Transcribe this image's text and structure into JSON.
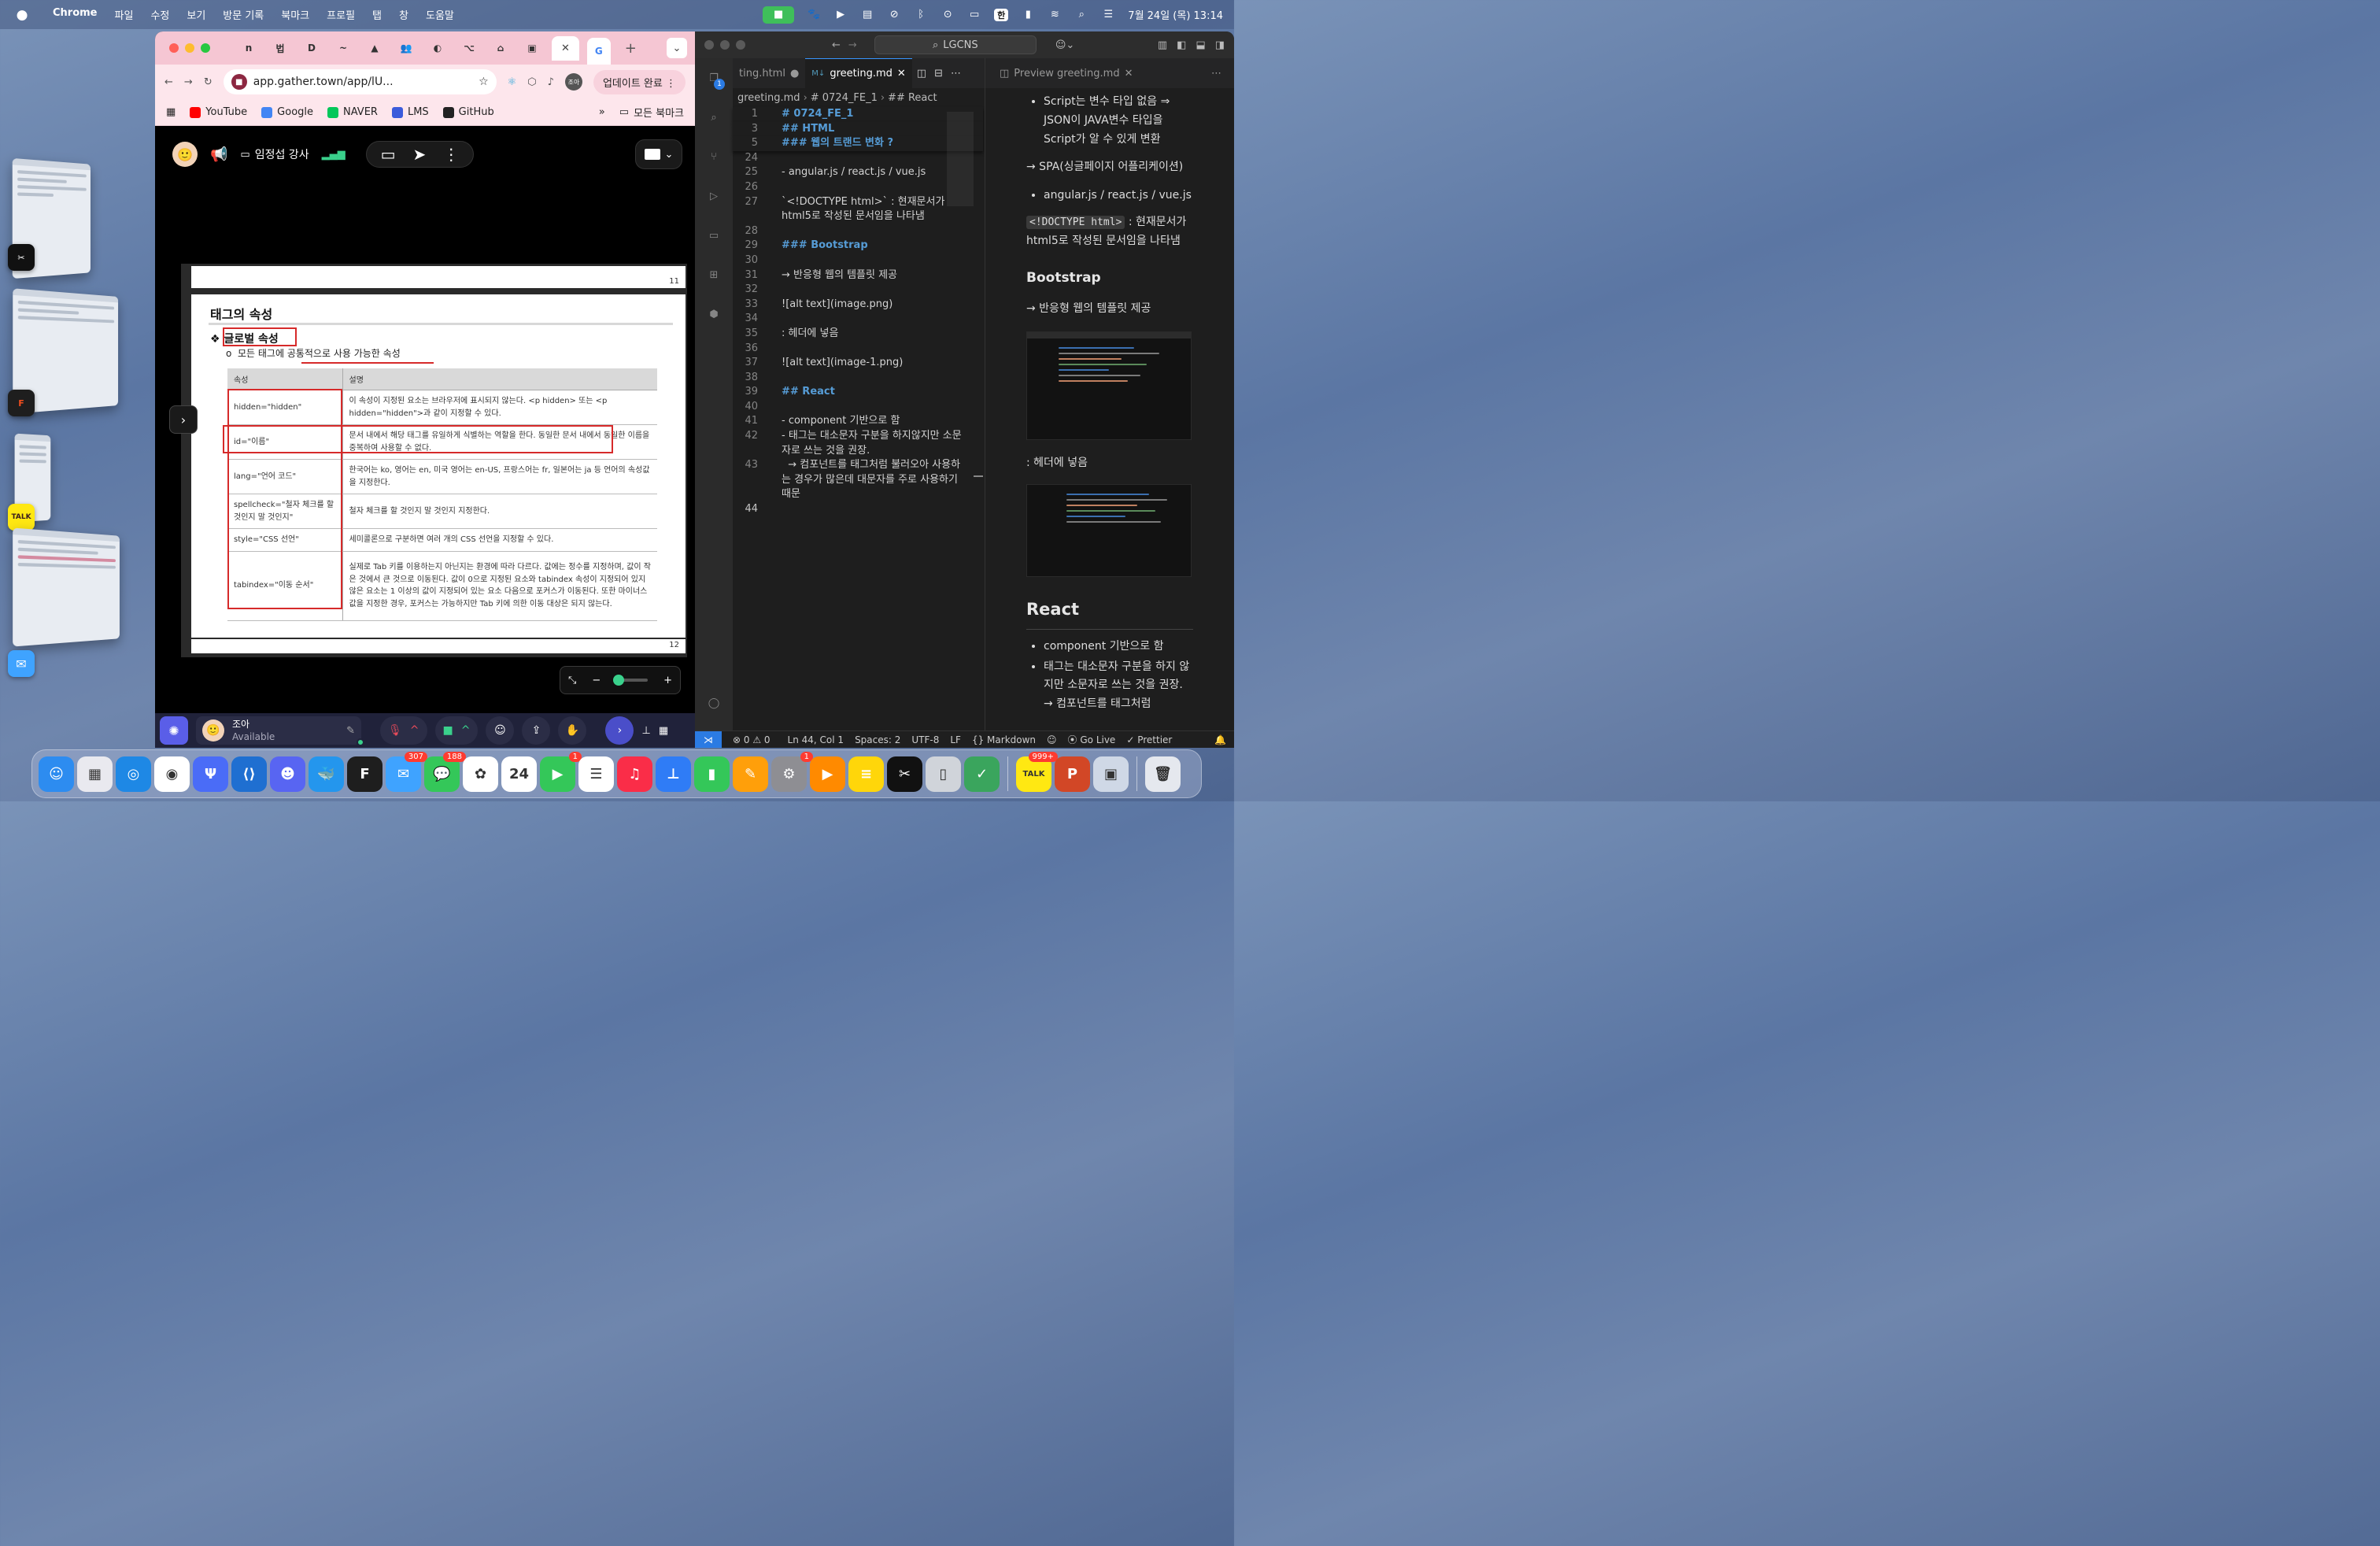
{
  "menubar": {
    "items": [
      "Chrome",
      "파일",
      "수정",
      "보기",
      "방문 기록",
      "북마크",
      "프로필",
      "탭",
      "창",
      "도움말"
    ],
    "input_method": "한",
    "clock": "7월 24일 (목) 13:14"
  },
  "chrome": {
    "tab_icons": [
      "n",
      "법",
      "D",
      "~",
      "▲",
      "👥",
      "◐",
      "⌥",
      "⌂",
      "▣",
      "G"
    ],
    "url": "app.gather.town/app/lU...",
    "profile_label": "조아",
    "update_label": "업데이트 완료",
    "bookmarks": [
      {
        "label": "YouTube",
        "color": "#ff0000"
      },
      {
        "label": "Google",
        "color": "#4285f4"
      },
      {
        "label": "NAVER",
        "color": "#03c75a"
      },
      {
        "label": "LMS",
        "color": "#3b5bdb"
      },
      {
        "label": "GitHub",
        "color": "#222222"
      }
    ],
    "all_bookmarks_label": "모든 북마크"
  },
  "gather": {
    "presenter": "임정섭 강사",
    "slide": {
      "page_top_number": "11",
      "page_bottom_number": "12",
      "title": "태그의 속성",
      "bullet_title": "글로벌 속성",
      "sub_bullet": "모든 태그에 공통적으로 사용 가능한 속성",
      "table_headers": [
        "속성",
        "설명"
      ],
      "table_rows": [
        {
          "attr": "hidden=\"hidden\"",
          "desc": "이 속성이 지정된 요소는 브라우저에 표시되지 않는다. <p hidden> 또는 <p hidden=\"hidden\">과 같이 지정할 수 있다."
        },
        {
          "attr": "id=\"이름\"",
          "desc": "문서 내에서 해당 태그를 유일하게 식별하는 역할을 한다. 동일한 문서 내에서 동일한 이름을 중복하여 사용할 수 없다."
        },
        {
          "attr": "lang=\"언어 코드\"",
          "desc": "한국어는 ko, 영어는 en, 미국 영어는 en-US, 프랑스어는 fr, 일본어는 ja 등 언어의 속성값을 지정한다."
        },
        {
          "attr": "spellcheck=\"철자 체크를 할 것인지 말 것인지\"",
          "desc": "철자 체크를 할 것인지 말 것인지 지정한다."
        },
        {
          "attr": "style=\"CSS 선언\"",
          "desc": "세미콜론으로 구분하면 여러 개의 CSS 선언을 지정할 수 있다."
        },
        {
          "attr": "tabindex=\"이동 순서\"",
          "desc": "실제로 Tab 키를 이용하는지 아닌지는 환경에 따라 다르다. 값에는 정수를 지정하며, 값이 작은 것에서 큰 것으로 이동된다. 값이 0으로 지정된 요소와 tabindex 속성이 지정되어 있지 않은 요소는 1 이상의 값이 지정되어 있는 요소 다음으로 포커스가 이동된다. 또한 마이너스 값을 지정한 경우, 포커스는 가능하지만 Tab 키에 의한 이동 대상은 되지 않는다."
        }
      ]
    },
    "user_name": "조아",
    "user_status": "Available"
  },
  "vscode": {
    "search_label": "LGCNS",
    "tabs": [
      {
        "label": "ting.html",
        "active": false
      },
      {
        "label": "greeting.md",
        "active": true
      }
    ],
    "preview_tab": "Preview greeting.md",
    "breadcrumb": [
      "greeting.md",
      "# 0724_FE_1",
      "## React"
    ],
    "sticky_lines": [
      {
        "num": "1",
        "text": "# 0724_FE_1"
      },
      {
        "num": "3",
        "text": "## HTML"
      },
      {
        "num": "5",
        "text": "### 웹의 트랜드 변화 ?"
      }
    ],
    "code_lines": [
      {
        "num": "24",
        "text": ""
      },
      {
        "num": "25",
        "text": "- angular.js / react.js / vue.js"
      },
      {
        "num": "26",
        "text": ""
      },
      {
        "num": "27",
        "text": "`<!DOCTYPE html>` : 현재문서가 html5로 작성된 문서임을 나타냄"
      },
      {
        "num": "28",
        "text": ""
      },
      {
        "num": "29",
        "text": "### Bootstrap"
      },
      {
        "num": "30",
        "text": ""
      },
      {
        "num": "31",
        "text": "→ 반응형 웹의 템플릿 제공"
      },
      {
        "num": "32",
        "text": ""
      },
      {
        "num": "33",
        "text": "![alt text](image.png)"
      },
      {
        "num": "34",
        "text": ""
      },
      {
        "num": "35",
        "text": ": 헤더에 넣음"
      },
      {
        "num": "36",
        "text": ""
      },
      {
        "num": "37",
        "text": "![alt text](image-1.png)"
      },
      {
        "num": "38",
        "text": ""
      },
      {
        "num": "39",
        "text": "## React"
      },
      {
        "num": "40",
        "text": ""
      },
      {
        "num": "41",
        "text": "- component 기반으로 함"
      },
      {
        "num": "42",
        "text": "- 태그는 대소문자 구분을 하지않지만 소문자로 쓰는 것을 권장."
      },
      {
        "num": "43",
        "text": "  → 컴포넌트를 태그처럼 불러오아 사용하는 경우가 많은데 대문자를 주로 사용하기 때문"
      },
      {
        "num": "44",
        "text": ""
      }
    ],
    "preview": {
      "top_bullet": "Script는 변수 타입 없음 ⇒ JSON이 JAVA변수 타입을 Script가 알 수 있게 변환",
      "spa_line": "→ SPA(싱글페이지 어플리케이션)",
      "frameworks": "angular.js / react.js / vue.js",
      "doctype_code": "<!DOCTYPE html>",
      "doctype_desc": ": 현재문서가 html5로 작성된 문서임을 나타냄",
      "bootstrap_heading": "Bootstrap",
      "bootstrap_line": "→ 반응형 웹의 템플릿 제공",
      "header_line": ": 헤더에 넣음",
      "react_heading": "React",
      "react_bullets": [
        "component 기반으로 함",
        "태그는 대소문자 구분을 하지 않지만 소문자로 쓰는 것을 권장. → 컴포넌트를 태그처럼"
      ]
    },
    "status": {
      "errors": "0",
      "warnings": "0",
      "position": "Ln 44, Col 1",
      "spaces": "Spaces: 2",
      "encoding": "UTF-8",
      "eol": "LF",
      "language": "Markdown",
      "go_live": "Go Live",
      "prettier": "Prettier"
    },
    "activity_badges": {
      "explorer": "1",
      "settings": "1"
    }
  },
  "dock": {
    "apps": [
      {
        "name": "Finder",
        "icon": "finder-icon",
        "color": "#2d8cf0",
        "glyph": "☺"
      },
      {
        "name": "Launchpad",
        "icon": "launchpad-icon",
        "color": "#e9e9ef",
        "glyph": "▦"
      },
      {
        "name": "Safari",
        "icon": "safari-icon",
        "color": "#1e88e5",
        "glyph": "◎"
      },
      {
        "name": "Chrome",
        "icon": "chrome-icon",
        "color": "#ffffff",
        "glyph": "◉"
      },
      {
        "name": "Fork",
        "icon": "fork-icon",
        "color": "#4a6cf7",
        "glyph": "Ψ"
      },
      {
        "name": "VS Code",
        "icon": "vscode-icon",
        "color": "#1f6fd1",
        "glyph": "⟨⟩"
      },
      {
        "name": "Discord",
        "icon": "discord-icon",
        "color": "#5865f2",
        "glyph": "☻"
      },
      {
        "name": "Docker",
        "icon": "docker-icon",
        "color": "#2496ed",
        "glyph": "🐳"
      },
      {
        "name": "Figma",
        "icon": "figma-icon",
        "color": "#1e1e1e",
        "glyph": "F"
      },
      {
        "name": "Mail",
        "icon": "mail-icon",
        "color": "#3fa3ff",
        "glyph": "✉",
        "badge": "307"
      },
      {
        "name": "Messages",
        "icon": "messages-icon",
        "color": "#34c759",
        "glyph": "💬",
        "badge": "188"
      },
      {
        "name": "Photos",
        "icon": "photos-icon",
        "color": "#ffffff",
        "glyph": "✿"
      },
      {
        "name": "Calendar",
        "icon": "calendar-icon",
        "color": "#ffffff",
        "glyph": "24",
        "dark": true
      },
      {
        "name": "FaceTime",
        "icon": "facetime-icon",
        "color": "#34c759",
        "glyph": "▶",
        "badge": "1"
      },
      {
        "name": "Reminders",
        "icon": "reminders-icon",
        "color": "#ffffff",
        "glyph": "☰",
        "dark": true
      },
      {
        "name": "Music",
        "icon": "music-icon",
        "color": "#fa2d48",
        "glyph": "♫"
      },
      {
        "name": "Keynote",
        "icon": "keynote-icon",
        "color": "#2f7cf6",
        "glyph": "⊥"
      },
      {
        "name": "Numbers",
        "icon": "numbers-icon",
        "color": "#34c759",
        "glyph": "▮"
      },
      {
        "name": "Pages",
        "icon": "pages-icon",
        "color": "#ff9f0a",
        "glyph": "✎"
      },
      {
        "name": "System Settings",
        "icon": "settings-icon",
        "color": "#8e8e93",
        "glyph": "⚙",
        "badge": "1"
      },
      {
        "name": "Infuse",
        "icon": "infuse-icon",
        "color": "#ff8a00",
        "glyph": "▶"
      },
      {
        "name": "Notes",
        "icon": "notes-icon",
        "color": "#ffd60a",
        "glyph": "≡"
      },
      {
        "name": "CapCut",
        "icon": "capcut-icon",
        "color": "#111111",
        "glyph": "✂"
      },
      {
        "name": "iPhone Mirroring",
        "icon": "iphone-icon",
        "color": "#d0d4da",
        "glyph": "▯"
      },
      {
        "name": "Xcode Cleaner",
        "icon": "cleaner-icon",
        "color": "#3aa55d",
        "glyph": "✓"
      }
    ],
    "recent_apps": [
      {
        "name": "KakaoTalk",
        "icon": "kakaotalk-icon",
        "color": "#ffe812",
        "glyph": "TALK",
        "badge": "999+",
        "dark": true
      },
      {
        "name": "PowerPoint",
        "icon": "powerpoint-icon",
        "color": "#d24726",
        "glyph": "P"
      },
      {
        "name": "Preview",
        "icon": "preview-icon",
        "color": "#cfd8e6",
        "glyph": "▣"
      }
    ],
    "trash": {
      "name": "Trash",
      "icon": "trash-icon",
      "color": "#e5e8ee",
      "glyph": "🗑"
    }
  }
}
